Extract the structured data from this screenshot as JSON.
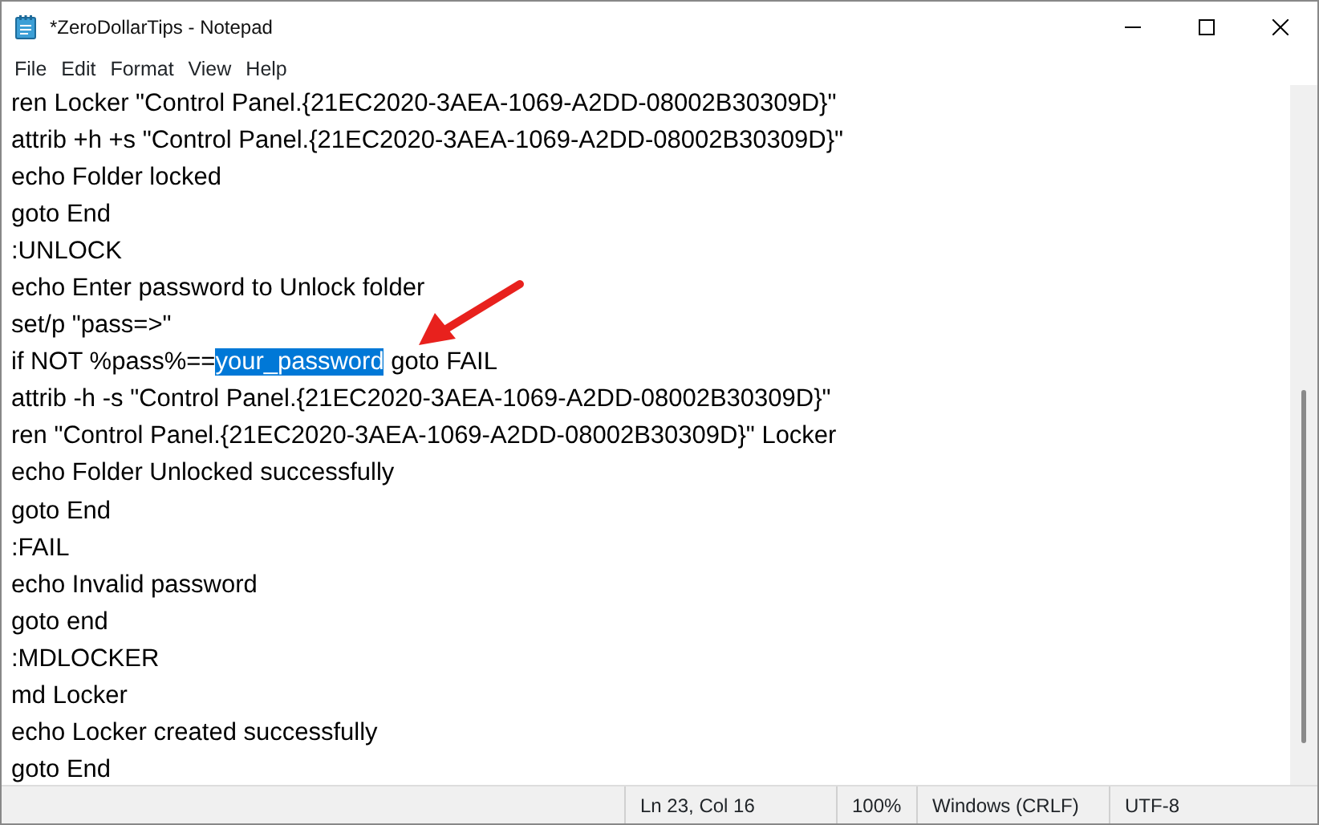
{
  "window": {
    "title": "*ZeroDollarTips - Notepad"
  },
  "menu": [
    "File",
    "Edit",
    "Format",
    "View",
    "Help"
  ],
  "editor": {
    "lines": [
      [
        {
          "text": "ren Locker \"Control Panel.{21EC2020-3AEA-1069-A2DD-08002B30309D}\"",
          "selected": false
        }
      ],
      [
        {
          "text": "attrib +h +s \"Control Panel.{21EC2020-3AEA-1069-A2DD-08002B30309D}\"",
          "selected": false
        }
      ],
      [
        {
          "text": "echo Folder locked",
          "selected": false
        }
      ],
      [
        {
          "text": "goto End",
          "selected": false
        }
      ],
      [
        {
          "text": ":UNLOCK",
          "selected": false
        }
      ],
      [
        {
          "text": "echo Enter password to Unlock folder",
          "selected": false
        }
      ],
      [
        {
          "text": "set/p \"pass=>\"",
          "selected": false
        }
      ],
      [
        {
          "text": "if NOT %pass%==",
          "selected": false
        },
        {
          "text": "your_password",
          "selected": true
        },
        {
          "text": " goto FAIL",
          "selected": false
        }
      ],
      [
        {
          "text": "attrib -h -s \"Control Panel.{21EC2020-3AEA-1069-A2DD-08002B30309D}\"",
          "selected": false
        }
      ],
      [
        {
          "text": "ren \"Control Panel.{21EC2020-3AEA-1069-A2DD-08002B30309D}\" Locker",
          "selected": false
        }
      ],
      [
        {
          "text": "echo Folder Unlocked successfully",
          "selected": false
        }
      ],
      [
        {
          "text": "goto End",
          "selected": false
        }
      ],
      [
        {
          "text": ":FAIL",
          "selected": false
        }
      ],
      [
        {
          "text": "echo Invalid password",
          "selected": false
        }
      ],
      [
        {
          "text": "goto end",
          "selected": false
        }
      ],
      [
        {
          "text": ":MDLOCKER",
          "selected": false
        }
      ],
      [
        {
          "text": "md Locker",
          "selected": false
        }
      ],
      [
        {
          "text": "echo Locker created successfully",
          "selected": false
        }
      ],
      [
        {
          "text": "goto End",
          "selected": false
        }
      ]
    ]
  },
  "status_bar": {
    "position": "Ln 23, Col 16",
    "zoom": "100%",
    "line_ending": "Windows (CRLF)",
    "encoding": "UTF-8"
  }
}
